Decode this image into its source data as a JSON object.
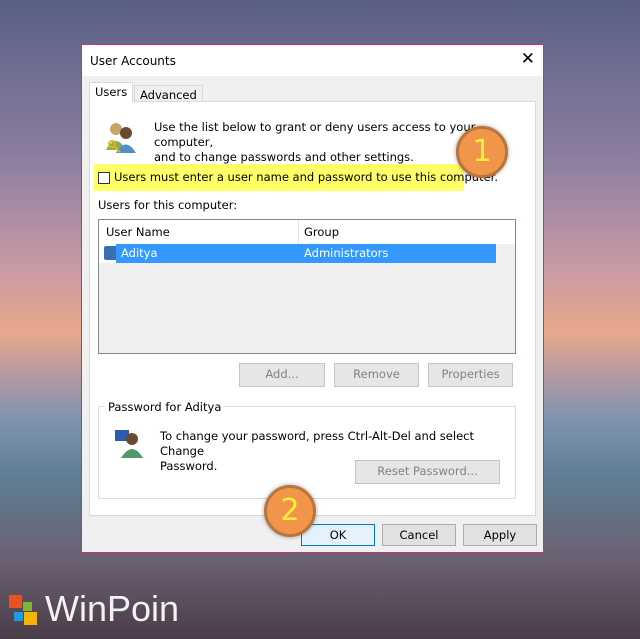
{
  "window": {
    "title": "User Accounts",
    "close": "✕"
  },
  "tabs": [
    {
      "label": "Users",
      "active": true
    },
    {
      "label": "Advanced",
      "active": false
    }
  ],
  "intro": {
    "line1": "Use the list below to grant or deny users access to your computer,",
    "line2": "and to change passwords and other settings."
  },
  "checkbox": {
    "label": "Users must enter a user name and password to use this computer.",
    "checked": false
  },
  "users_label": "Users for this computer:",
  "table": {
    "columns": [
      "User Name",
      "Group"
    ],
    "rows": [
      {
        "name": "Aditya",
        "group": "Administrators",
        "selected": true
      }
    ]
  },
  "buttons": {
    "add": "Add...",
    "remove": "Remove",
    "properties": "Properties",
    "reset": "Reset Password...",
    "ok": "OK",
    "cancel": "Cancel",
    "apply": "Apply"
  },
  "password_group": {
    "title": "Password for Aditya",
    "line1": "To change your password, press Ctrl-Alt-Del and select Change",
    "line2": "Password."
  },
  "annotations": [
    "1",
    "2"
  ],
  "logo": "WinPoin",
  "colors": {
    "selection": "#3399ff",
    "highlight": "#ffff66",
    "annotation": "#f0954a"
  }
}
